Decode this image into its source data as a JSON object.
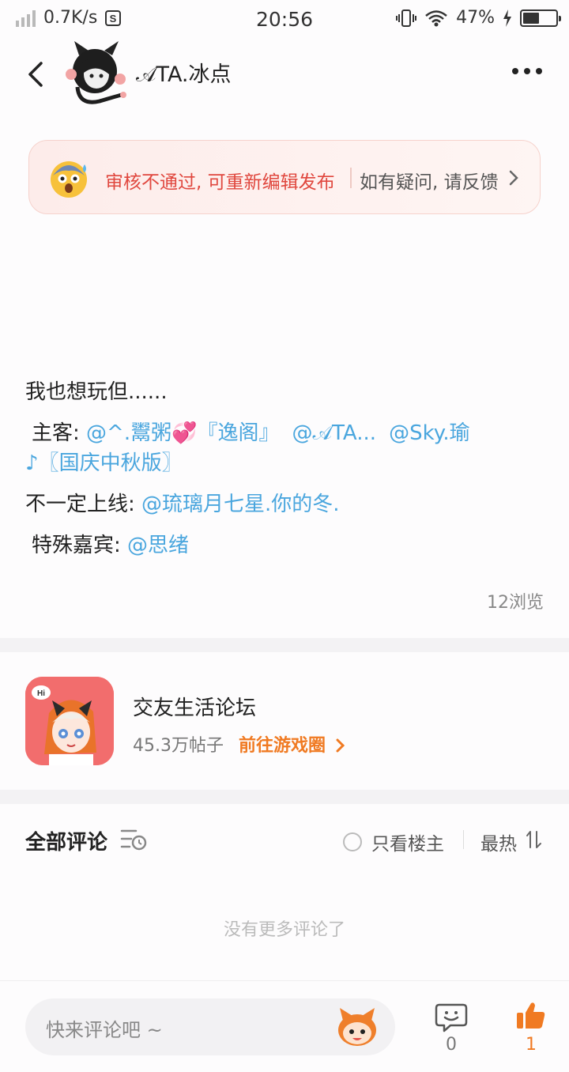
{
  "status_bar": {
    "network_speed": "0.7K/s",
    "time": "20:56",
    "battery_percent": "47%",
    "battery_level": 0.47
  },
  "header": {
    "author_name": "𝒜TA.冰点",
    "icons": [
      "back-icon",
      "avatar",
      "more-icon"
    ]
  },
  "review_banner": {
    "status_text": "审核不通过, 可重新编辑发布",
    "feedback_text": "如有疑问, 请反馈",
    "accent_color": "#e0473e"
  },
  "post": {
    "line1": "我也想玩但......",
    "host_label": "主客: ",
    "host_mention1": "@^.鬻粥💞『逸阁』",
    "host_mention2": "@𝒜TA...",
    "host_mention3": "@Sky.瑜",
    "host_mention3_cont": "♪〖国庆中秋版〗",
    "maybe_label": "不一定上线: ",
    "maybe_mention": "@琉璃月七星.你的冬.",
    "guest_label": "特殊嘉宾: ",
    "guest_mention": "@思绪",
    "views": "12浏览",
    "mention_color": "#4aa6de"
  },
  "forum": {
    "name": "交友生活论坛",
    "post_count": "45.3万帖子",
    "goto_label": "前往游戏圈",
    "link_color": "#f07a22"
  },
  "comments": {
    "title": "全部评论",
    "only_author_label": "只看楼主",
    "sort_label": "最热",
    "empty_text": "没有更多评论了"
  },
  "bottom_bar": {
    "input_placeholder": "快来评论吧 ~",
    "comment_count": "0",
    "like_count": "1"
  }
}
